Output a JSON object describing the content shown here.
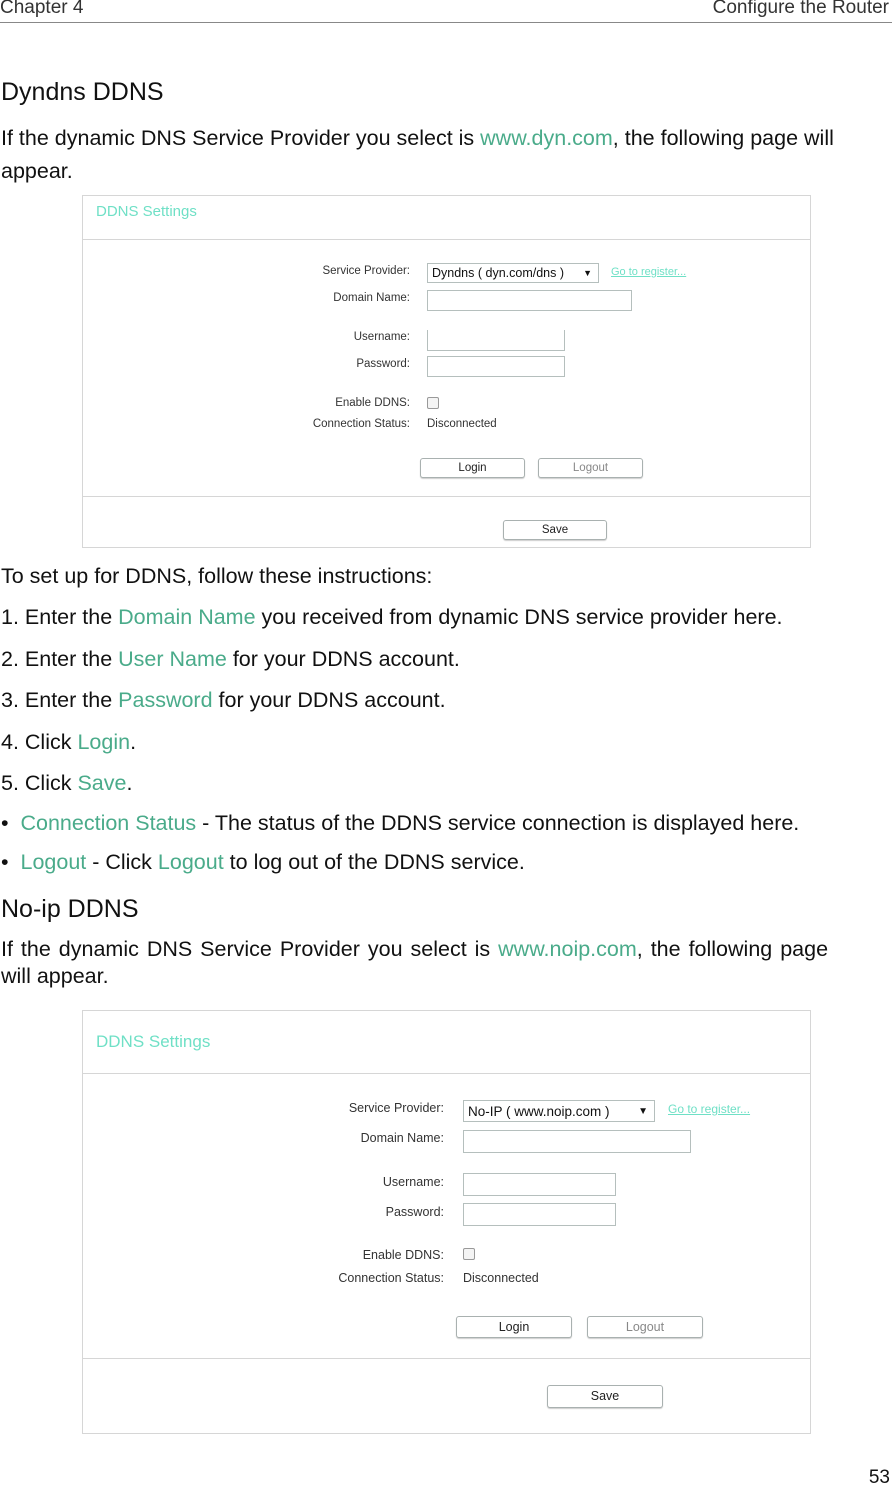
{
  "header": {
    "chapter": "Chapter 4",
    "section": "Configure the Router"
  },
  "dyndns": {
    "heading": "Dyndns DDNS",
    "intro_pre": "If the dynamic DNS Service Provider you select is ",
    "intro_link": "www.dyn.com",
    "intro_post": ", the following page will",
    "intro_line2": "appear.",
    "panel": {
      "title": "DDNS Settings",
      "service_provider_label": "Service Provider:",
      "service_provider_value": "Dyndns ( dyn.com/dns )",
      "register_link": "Go to register...",
      "domain_label": "Domain Name:",
      "username_label": "Username:",
      "password_label": "Password:",
      "enable_label": "Enable DDNS:",
      "enable_checked": false,
      "status_label": "Connection Status:",
      "status_value": "Disconnected",
      "login": "Login",
      "logout": "Logout",
      "save": "Save"
    }
  },
  "instructions": {
    "intro": "To set up for DDNS, follow these instructions:",
    "steps": [
      {
        "pre": "1. Enter the ",
        "hl": "Domain Name",
        "post": " you received from dynamic DNS service provider here."
      },
      {
        "pre": "2. Enter the ",
        "hl": "User Name",
        "post": " for your DDNS account."
      },
      {
        "pre": "3. Enter the ",
        "hl": "Password",
        "post": " for your DDNS account."
      },
      {
        "pre": "4. Click ",
        "hl": "Login",
        "post": "."
      },
      {
        "pre": "5. Click ",
        "hl": "Save",
        "post": "."
      }
    ],
    "bullets": [
      {
        "hl": "Connection Status",
        "post": " - The status of the DDNS service connection is displayed here."
      },
      {
        "hl": "Logout",
        "mid": " - Click ",
        "hl2": "Logout",
        "post": " to log out of the DDNS service."
      }
    ]
  },
  "noip": {
    "heading": "No-ip DDNS",
    "intro_pre": "If the dynamic DNS Service Provider you select is ",
    "intro_link": "www.noip.com",
    "intro_post": ", the following page",
    "intro_line2": "will appear.",
    "panel": {
      "title": "DDNS Settings",
      "service_provider_label": "Service Provider:",
      "service_provider_value": "No-IP ( www.noip.com )",
      "register_link": "Go to register...",
      "domain_label": "Domain Name:",
      "username_label": "Username:",
      "password_label": "Password:",
      "enable_label": "Enable DDNS:",
      "enable_checked": false,
      "status_label": "Connection Status:",
      "status_value": "Disconnected",
      "login": "Login",
      "logout": "Logout",
      "save": "Save"
    }
  },
  "page_number": "53",
  "colors": {
    "accent": "#4aab8a",
    "panel_title": "#6fe0c6"
  }
}
